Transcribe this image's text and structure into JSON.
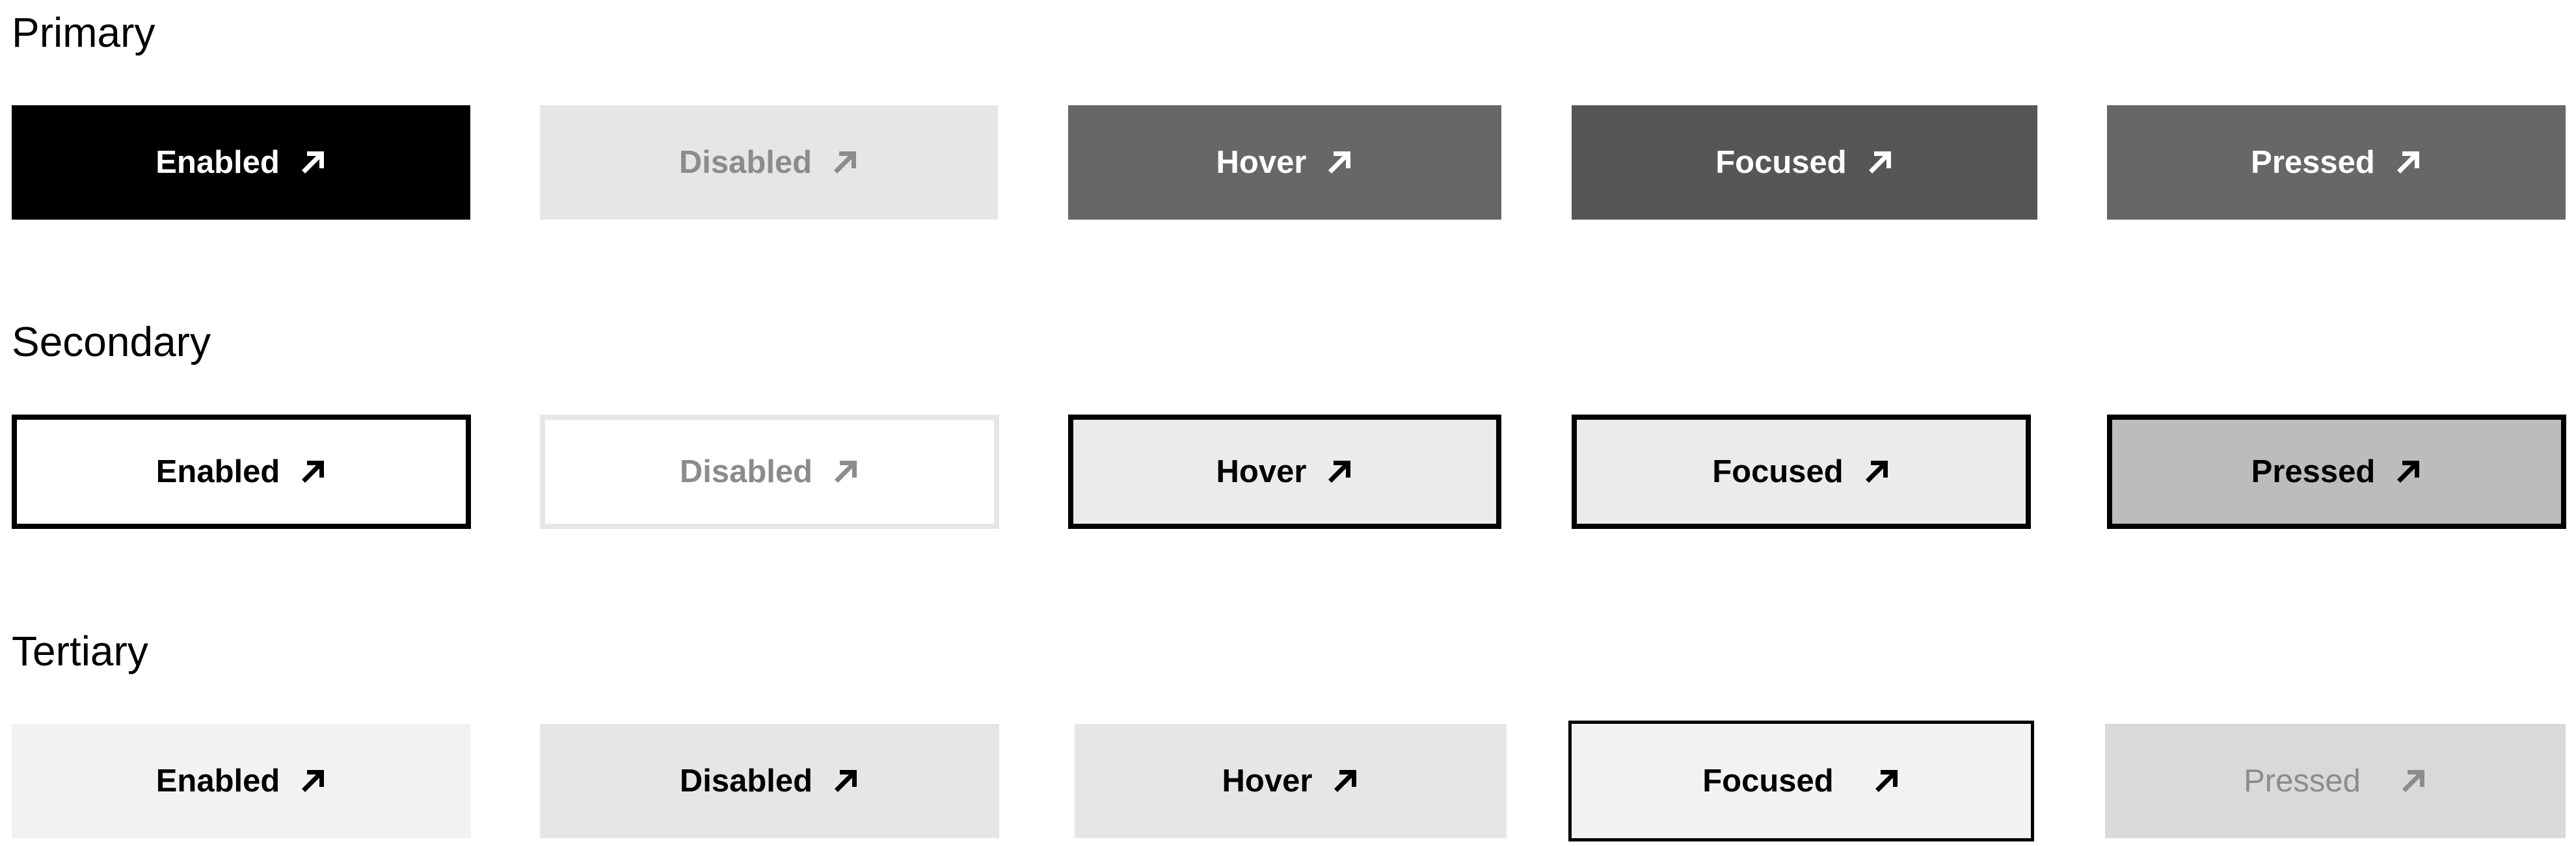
{
  "sections": [
    {
      "title": "Primary",
      "buttons": [
        {
          "label": "Enabled",
          "icon": "arrow-up-right-icon",
          "bg": "#000000",
          "fg": "#ffffff",
          "border": "none"
        },
        {
          "label": "Disabled",
          "icon": "arrow-up-right-icon",
          "bg": "#e6e6e6",
          "fg": "#8c8c8c",
          "border": "none"
        },
        {
          "label": "Hover",
          "icon": "arrow-up-right-icon",
          "bg": "#676767",
          "fg": "#ffffff",
          "border": "none"
        },
        {
          "label": "Focused",
          "icon": "arrow-up-right-icon",
          "bg": "#565656",
          "fg": "#ffffff",
          "border": "none"
        },
        {
          "label": "Pressed",
          "icon": "arrow-up-right-icon",
          "bg": "#676767",
          "fg": "#ffffff",
          "border": "none"
        }
      ]
    },
    {
      "title": "Secondary",
      "buttons": [
        {
          "label": "Enabled",
          "icon": "arrow-up-right-icon",
          "bg": "#ffffff",
          "fg": "#000000",
          "border": "#000000"
        },
        {
          "label": "Disabled",
          "icon": "arrow-up-right-icon",
          "bg": "#ffffff",
          "fg": "#8c8c8c",
          "border": "#e6e6e6"
        },
        {
          "label": "Hover",
          "icon": "arrow-up-right-icon",
          "bg": "#ebebeb",
          "fg": "#000000",
          "border": "#000000"
        },
        {
          "label": "Focused",
          "icon": "arrow-up-right-icon",
          "bg": "#ebebeb",
          "fg": "#000000",
          "border": "#000000"
        },
        {
          "label": "Pressed",
          "icon": "arrow-up-right-icon",
          "bg": "#bcbcbc",
          "fg": "#000000",
          "border": "#000000"
        }
      ]
    },
    {
      "title": "Tertiary",
      "buttons": [
        {
          "label": "Enabled",
          "icon": "arrow-up-right-icon",
          "bg": "#f2f2f2",
          "fg": "#000000",
          "border": "none"
        },
        {
          "label": "Disabled",
          "icon": "arrow-up-right-icon",
          "bg": "#e6e6e6",
          "fg": "#000000",
          "border": "none"
        },
        {
          "label": "Hover",
          "icon": "arrow-up-right-icon",
          "bg": "#e6e6e6",
          "fg": "#000000",
          "border": "none"
        },
        {
          "label": "Focused",
          "icon": "arrow-up-right-icon",
          "bg": "#f2f2f2",
          "fg": "#000000",
          "border": "#000000"
        },
        {
          "label": "Pressed",
          "icon": "arrow-up-right-icon",
          "bg": "#d9d9d9",
          "fg": "#8c8c8c",
          "border": "none"
        }
      ]
    }
  ]
}
